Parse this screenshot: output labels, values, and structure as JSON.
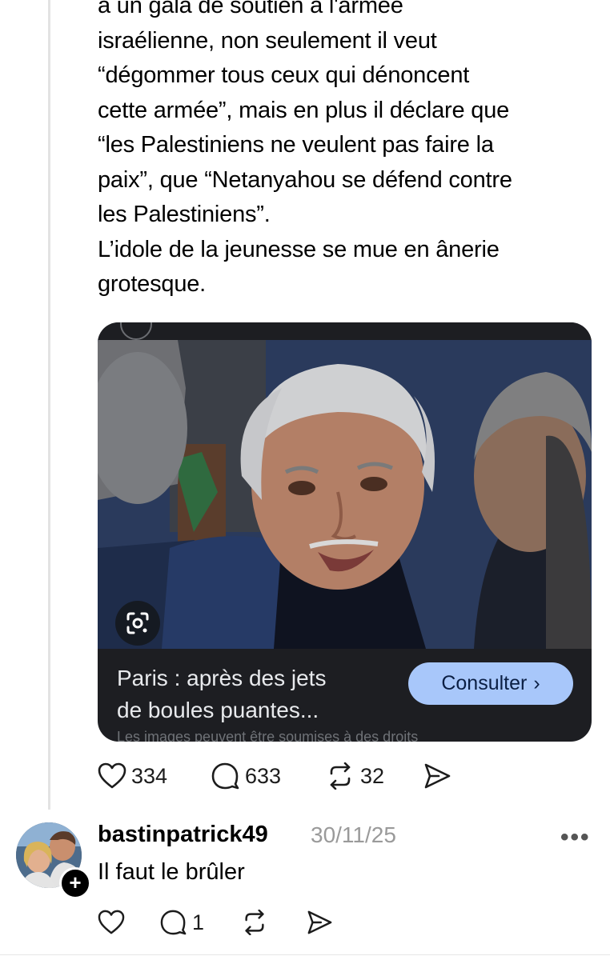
{
  "post": {
    "text_lines": [
      "à un gala de soutien à l'armée",
      "israélienne, non seulement il veut",
      "“dégommer tous ceux qui dénoncent",
      "cette armée”, mais en plus il déclare que",
      "“les Palestiniens ne veulent pas faire la",
      "paix”, que “Netanyahou se défend contre",
      "les Palestiniens”.",
      "L’idole de la jeunesse se mue en ânerie",
      "grotesque."
    ],
    "card": {
      "title_line1": "Paris : après des jets",
      "title_line2": "de boules puantes...",
      "button_label": "Consulter",
      "button_chevron": "›",
      "caption": "Les images peuvent être soumises à des droits",
      "lens_icon": "google-lens-icon"
    },
    "stats": {
      "likes": "334",
      "comments": "633",
      "reposts": "32"
    }
  },
  "reply": {
    "username": "bastinpatrick49",
    "date": "30/11/25",
    "more": "•••",
    "text": "Il faut le brûler",
    "follow_badge": "+",
    "stats": {
      "likes": "",
      "comments": "1",
      "reposts": ""
    }
  },
  "colors": {
    "card_bg": "#1d1e22",
    "button_bg": "#a8c7fa",
    "button_text": "#0b1f44",
    "date_gray": "#9a9a9a"
  }
}
